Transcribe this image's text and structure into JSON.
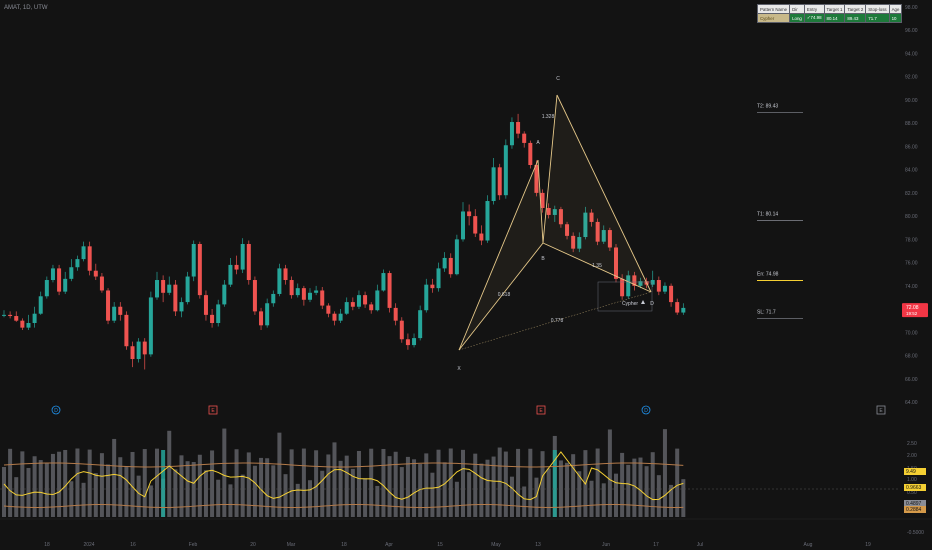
{
  "symbol": "AMAT, 1D, UTW",
  "colors": {
    "up": "#26a69a",
    "down": "#ef5350",
    "pattern": "#e6c98a",
    "volume": "#8a8d96",
    "oscillator": "#f5d033",
    "band": "#b37a4a",
    "background": "#131313",
    "price_badge": "#f23645"
  },
  "table": {
    "headers": [
      "Pattern Name",
      "Dir",
      "Entry",
      "Target 1",
      "Target 2",
      "Stop-loss",
      "Age"
    ],
    "row": [
      "Cypher",
      "Long",
      "✓74.98",
      "80.14",
      "89.43",
      "71.7",
      "10"
    ]
  },
  "levels": {
    "t2": "T2: 89.43",
    "t1": "T1: 80.14",
    "entry": "En: 74.98",
    "stop": "SL: 71.7"
  },
  "price_badge": {
    "value": "72.08",
    "countdown": "19:52"
  },
  "pattern": {
    "name": "Cypher",
    "points": [
      "X",
      "A",
      "B",
      "C",
      "D"
    ],
    "ratios": [
      "1.328",
      "0.618",
      "1.35",
      "0.778"
    ]
  },
  "events": [
    "D",
    "E",
    "E",
    "D",
    "E"
  ],
  "chart_data": {
    "type": "candlestick",
    "price_axis": {
      "min": 64,
      "max": 98,
      "ticks": [
        "64.00",
        "66.00",
        "68.00",
        "70.00",
        "72.00",
        "74.00",
        "76.00",
        "78.00",
        "80.00",
        "82.00",
        "84.00",
        "86.00",
        "88.00",
        "90.00",
        "92.00",
        "94.00",
        "96.00",
        "98.00"
      ]
    },
    "x_ticks": [
      "18",
      "2024",
      "16",
      "Feb",
      "20",
      "Mar",
      "18",
      "Apr",
      "15",
      "May",
      "13",
      "Jun",
      "17",
      "Jul",
      "Aug",
      "19"
    ],
    "candles": [
      [
        71.5,
        71.5,
        71.9,
        71.3,
        71.3
      ],
      [
        71.5,
        71.4,
        71.8,
        71.2,
        71.2
      ],
      [
        71.4,
        71.0,
        71.8,
        70.9,
        70.9
      ],
      [
        71.0,
        70.4,
        71.2,
        70.2,
        70.2
      ],
      [
        70.4,
        70.8,
        71.5,
        70.2,
        70.2
      ],
      [
        70.8,
        71.6,
        72.2,
        70.4,
        70.4
      ],
      [
        71.6,
        73.1,
        73.5,
        71.5,
        71.5
      ],
      [
        73.1,
        74.5,
        74.8,
        72.9,
        72.9
      ],
      [
        74.5,
        75.5,
        75.8,
        74.3,
        74.3
      ],
      [
        75.5,
        73.5,
        75.8,
        73.2,
        73.2
      ],
      [
        73.5,
        74.6,
        75.2,
        73.3,
        73.3
      ],
      [
        74.6,
        75.6,
        76.3,
        74.4,
        74.4
      ],
      [
        75.6,
        76.3,
        76.6,
        75.3,
        75.3
      ],
      [
        76.3,
        77.4,
        77.8,
        76.1,
        76.1
      ],
      [
        77.4,
        75.3,
        77.8,
        74.9,
        74.9
      ],
      [
        75.3,
        74.8,
        75.9,
        74.5,
        74.5
      ],
      [
        74.8,
        73.6,
        75.1,
        73.4,
        73.4
      ],
      [
        73.6,
        71.0,
        73.8,
        70.7,
        70.7
      ],
      [
        71.0,
        72.2,
        72.6,
        70.8,
        70.8
      ],
      [
        72.2,
        71.5,
        72.6,
        71.0,
        71.0
      ],
      [
        71.5,
        68.8,
        71.8,
        68.5,
        68.5
      ],
      [
        68.8,
        67.7,
        69.2,
        67.0,
        67.0
      ],
      [
        67.7,
        69.2,
        69.5,
        67.4,
        67.4
      ],
      [
        69.2,
        68.1,
        69.5,
        66.8,
        66.8
      ],
      [
        68.1,
        73.0,
        73.5,
        67.9,
        67.9
      ],
      [
        73.0,
        74.5,
        75.2,
        72.8,
        72.8
      ],
      [
        74.5,
        73.4,
        74.9,
        72.6,
        72.6
      ],
      [
        73.4,
        74.1,
        74.8,
        73.2,
        73.2
      ],
      [
        74.1,
        71.8,
        74.5,
        71.4,
        71.4
      ],
      [
        71.8,
        72.6,
        73.0,
        71.3,
        71.3
      ],
      [
        72.6,
        74.8,
        75.2,
        72.4,
        72.4
      ],
      [
        74.8,
        77.6,
        77.9,
        74.4,
        74.4
      ],
      [
        77.6,
        73.2,
        77.8,
        72.9,
        72.9
      ],
      [
        73.2,
        71.5,
        73.6,
        71.0,
        71.0
      ],
      [
        71.5,
        70.8,
        72.0,
        70.4,
        70.4
      ],
      [
        70.8,
        72.4,
        72.8,
        70.5,
        70.5
      ],
      [
        72.4,
        74.1,
        74.5,
        72.2,
        72.2
      ],
      [
        74.1,
        75.8,
        76.4,
        73.9,
        73.9
      ],
      [
        75.8,
        75.4,
        76.6,
        75.0,
        75.0
      ],
      [
        75.4,
        77.6,
        78.1,
        75.1,
        75.1
      ],
      [
        77.6,
        74.5,
        77.9,
        74.1,
        74.1
      ],
      [
        74.5,
        71.8,
        74.8,
        71.5,
        71.5
      ],
      [
        71.8,
        70.6,
        72.1,
        70.2,
        70.2
      ],
      [
        70.6,
        72.5,
        72.9,
        70.4,
        70.4
      ],
      [
        72.5,
        73.3,
        73.6,
        72.2,
        72.2
      ],
      [
        73.3,
        75.5,
        75.9,
        73.1,
        73.1
      ],
      [
        75.5,
        74.5,
        75.8,
        74.1,
        74.1
      ],
      [
        74.5,
        73.2,
        74.8,
        72.9,
        72.9
      ],
      [
        73.2,
        73.8,
        74.2,
        73.0,
        73.0
      ],
      [
        73.8,
        72.8,
        74.0,
        72.3,
        72.3
      ],
      [
        72.8,
        73.4,
        73.8,
        72.6,
        72.6
      ],
      [
        73.4,
        73.6,
        74.0,
        73.2,
        73.2
      ],
      [
        73.6,
        72.3,
        73.9,
        72.0,
        72.0
      ],
      [
        72.3,
        71.6,
        72.5,
        71.3,
        71.3
      ],
      [
        71.6,
        71.0,
        71.8,
        70.6,
        70.6
      ],
      [
        71.0,
        71.6,
        72.0,
        70.8,
        70.8
      ],
      [
        71.6,
        72.6,
        73.0,
        71.5,
        71.5
      ],
      [
        72.6,
        72.2,
        73.0,
        71.9,
        71.9
      ],
      [
        72.2,
        73.2,
        73.6,
        72.0,
        72.0
      ],
      [
        73.2,
        72.4,
        73.5,
        72.1,
        72.1
      ],
      [
        72.4,
        71.9,
        72.6,
        71.6,
        71.6
      ],
      [
        71.9,
        73.6,
        74.1,
        71.8,
        71.8
      ],
      [
        73.6,
        75.1,
        75.4,
        73.5,
        73.5
      ],
      [
        75.1,
        72.1,
        75.3,
        71.7,
        71.7
      ],
      [
        72.1,
        71.0,
        72.5,
        70.6,
        70.6
      ],
      [
        71.0,
        69.4,
        71.3,
        69.1,
        69.1
      ],
      [
        69.4,
        68.9,
        69.9,
        68.5,
        68.5
      ],
      [
        68.9,
        69.5,
        69.9,
        68.7,
        68.7
      ],
      [
        69.5,
        71.9,
        72.3,
        69.3,
        69.3
      ],
      [
        71.9,
        74.1,
        74.6,
        71.7,
        71.7
      ],
      [
        74.1,
        73.8,
        74.6,
        73.4,
        73.4
      ],
      [
        73.8,
        75.5,
        76.0,
        73.5,
        73.5
      ],
      [
        75.5,
        76.4,
        76.9,
        75.2,
        75.2
      ],
      [
        76.4,
        75.0,
        76.8,
        74.7,
        74.7
      ],
      [
        75.0,
        78.0,
        78.4,
        74.9,
        74.9
      ],
      [
        78.0,
        80.4,
        81.2,
        77.8,
        77.8
      ],
      [
        80.4,
        80.0,
        81.0,
        79.2,
        79.2
      ],
      [
        80.0,
        78.5,
        80.6,
        78.2,
        78.2
      ],
      [
        78.5,
        77.9,
        79.2,
        77.5,
        77.5
      ],
      [
        77.9,
        81.3,
        81.8,
        77.7,
        77.7
      ],
      [
        81.3,
        84.2,
        85.0,
        81.0,
        81.0
      ],
      [
        84.2,
        81.8,
        84.5,
        81.4,
        81.4
      ],
      [
        81.8,
        86.1,
        86.6,
        81.5,
        81.5
      ],
      [
        86.1,
        88.1,
        88.5,
        85.8,
        85.8
      ],
      [
        88.1,
        87.1,
        88.8,
        86.7,
        86.7
      ],
      [
        87.1,
        86.3,
        87.3,
        85.9,
        85.9
      ],
      [
        86.3,
        84.4,
        86.5,
        84.1,
        84.1
      ],
      [
        84.4,
        82.0,
        84.8,
        81.7,
        81.7
      ],
      [
        82.0,
        80.7,
        82.3,
        80.3,
        80.3
      ],
      [
        80.7,
        80.1,
        81.1,
        79.8,
        79.8
      ],
      [
        80.1,
        80.6,
        80.9,
        79.5,
        79.5
      ],
      [
        80.6,
        79.3,
        80.8,
        79.0,
        79.0
      ],
      [
        79.3,
        78.3,
        79.5,
        78.0,
        78.0
      ],
      [
        78.3,
        77.2,
        78.6,
        76.9,
        76.9
      ],
      [
        77.2,
        78.2,
        78.6,
        76.9,
        76.9
      ],
      [
        78.2,
        80.3,
        80.8,
        78.0,
        78.0
      ],
      [
        80.3,
        79.5,
        80.6,
        79.1,
        79.1
      ],
      [
        79.5,
        77.8,
        79.8,
        77.5,
        77.5
      ],
      [
        77.8,
        78.8,
        79.2,
        77.6,
        77.6
      ],
      [
        78.8,
        77.3,
        79.0,
        77.0,
        77.0
      ],
      [
        77.3,
        74.6,
        77.6,
        74.3,
        74.3
      ],
      [
        74.6,
        73.1,
        75.0,
        72.8,
        72.8
      ],
      [
        73.1,
        74.9,
        75.3,
        72.9,
        72.9
      ],
      [
        74.9,
        74.0,
        75.2,
        73.6,
        73.6
      ],
      [
        74.0,
        74.4,
        74.7,
        73.8,
        73.8
      ],
      [
        74.4,
        74.1,
        74.7,
        73.8,
        73.8
      ],
      [
        74.1,
        74.5,
        75.3,
        73.9,
        73.9
      ],
      [
        74.5,
        73.5,
        74.8,
        73.2,
        73.2
      ],
      [
        73.5,
        74.0,
        74.3,
        73.3,
        73.3
      ],
      [
        74.0,
        72.6,
        74.2,
        72.2,
        72.2
      ],
      [
        72.6,
        71.7,
        72.9,
        71.5,
        71.5
      ],
      [
        71.7,
        72.1,
        72.5,
        71.5,
        71.5
      ]
    ],
    "oscillator": {
      "markers": [
        "9.49",
        "0.9663",
        "0.4897",
        "0.2884"
      ],
      "ticks": [
        "2.50",
        "2.00",
        "1.50",
        "1.00",
        "0.50",
        "0.00",
        "-0.5000"
      ]
    }
  }
}
